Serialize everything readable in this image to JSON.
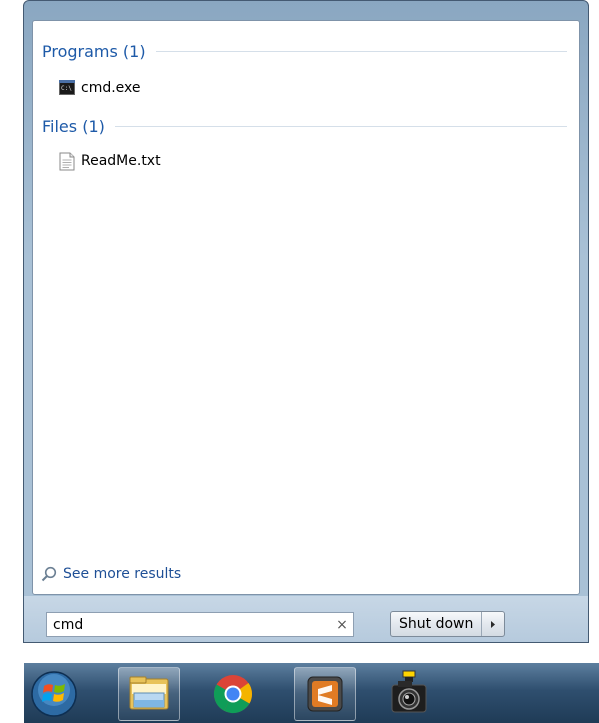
{
  "results": {
    "groups": [
      {
        "title": "Programs (1)",
        "items": [
          {
            "label": "cmd.exe",
            "icon": "command-prompt-icon"
          }
        ]
      },
      {
        "title": "Files (1)",
        "items": [
          {
            "label": "ReadMe.txt",
            "icon": "text-file-icon"
          }
        ]
      }
    ],
    "see_more_label": "See more results"
  },
  "search": {
    "value": "cmd",
    "clear_glyph": "×"
  },
  "power": {
    "shutdown_label": "Shut down"
  },
  "taskbar": {
    "items": [
      {
        "icon": "windows-start-orb-icon"
      },
      {
        "icon": "windows-explorer-icon"
      },
      {
        "icon": "chrome-icon"
      },
      {
        "icon": "sublime-text-icon"
      },
      {
        "icon": "camera-icon"
      }
    ]
  },
  "colors": {
    "group_title": "#1e5aa8",
    "link": "#1e4f96",
    "taskbar": "#2f4f6f"
  }
}
